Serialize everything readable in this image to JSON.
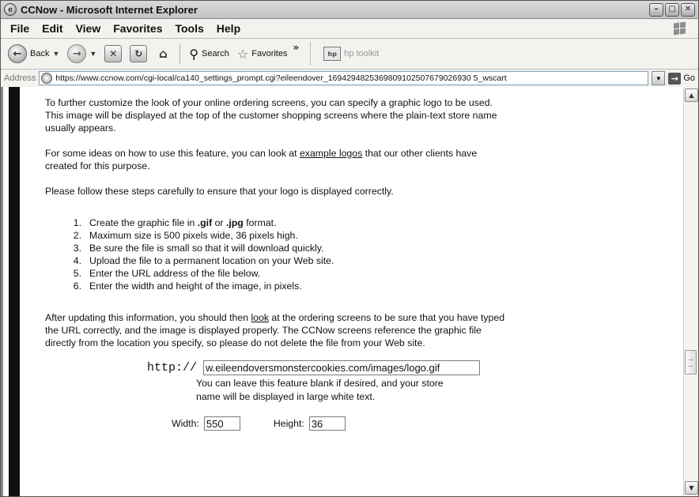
{
  "window": {
    "title": "CCNow - Microsoft Internet Explorer",
    "controls": {
      "minimize": "–",
      "maximize": "□",
      "close": "✕"
    }
  },
  "menu": [
    "File",
    "Edit",
    "View",
    "Favorites",
    "Tools",
    "Help"
  ],
  "toolbar": {
    "back_label": "Back",
    "search_label": "Search",
    "favorites_label": "Favorites",
    "more": "»",
    "hp_label": "hp toolkit"
  },
  "address": {
    "label": "Address",
    "url": "https://www.ccnow.com/cgi-local/ca140_settings_prompt.cgi?eileendover_1694294825369809102507679026930 5_wscart",
    "go_label": "Go"
  },
  "content": {
    "para1": "To further customize the look of your online ordering screens, you can specify a graphic logo to be used.  This image will be displayed at the top of the customer shopping screens where the plain-text store name usually appears.",
    "para2_before": "For some ideas on how to use this feature, you can look at ",
    "para2_link": "example logos",
    "para2_after": " that our other clients have created for this purpose.",
    "para3": "Please follow these steps carefully to ensure that your logo is displayed correctly.",
    "steps": [
      {
        "num": "1.",
        "pre": "Create the graphic file in ",
        "b1": ".gif",
        "mid": " or ",
        "b2": ".jpg",
        "post": " format."
      },
      {
        "num": "2.",
        "text": "Maximum size is 500 pixels wide, 36 pixels high."
      },
      {
        "num": "3.",
        "text": "Be sure the file is small so that it will download quickly."
      },
      {
        "num": "4.",
        "text": "Upload the file to a permanent location on your Web site."
      },
      {
        "num": "5.",
        "text": "Enter the URL address of the file below."
      },
      {
        "num": "6.",
        "text": "Enter the width and height of the image, in pixels."
      }
    ],
    "para4_before": "After updating this information, you should then ",
    "para4_link": "look",
    "para4_after": " at the ordering screens to be sure that you have typed the URL correctly, and the image is displayed properly.  The CCNow screens reference the graphic file directly from the location you specify, so please do not delete the file from your Web site.",
    "url_label": "http://",
    "url_value": "w.eileendoversmonstercookies.com/images/logo.gif",
    "url_hint": "You can leave this feature blank if desired, and your store name will be displayed in large white text.",
    "width_label": "Width:",
    "width_value": "550",
    "height_label": "Height:",
    "height_value": "36"
  },
  "scrollbar": {
    "position": 0.58,
    "up": "▲",
    "down": "▼"
  }
}
